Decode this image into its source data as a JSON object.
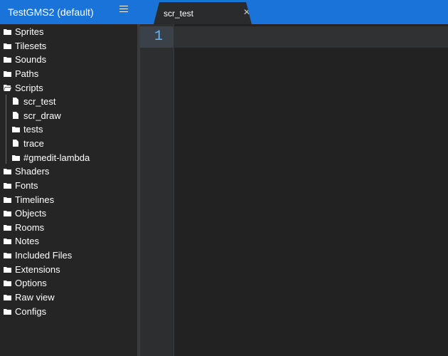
{
  "project": {
    "title": "TestGMS2 (default)"
  },
  "tab": {
    "label": "scr_test",
    "close_glyph": "✕"
  },
  "tree": [
    {
      "label": "Sprites",
      "icon": "folder-icon"
    },
    {
      "label": "Tilesets",
      "icon": "folder-icon"
    },
    {
      "label": "Sounds",
      "icon": "folder-icon"
    },
    {
      "label": "Paths",
      "icon": "folder-icon"
    },
    {
      "label": "Scripts",
      "icon": "folder-open-icon",
      "expanded": true
    },
    {
      "label": "scr_test",
      "icon": "file-icon"
    },
    {
      "label": "scr_draw",
      "icon": "file-icon"
    },
    {
      "label": "tests",
      "icon": "folder-icon"
    },
    {
      "label": "trace",
      "icon": "file-icon"
    },
    {
      "label": "#gmedit-lambda",
      "icon": "folder-icon"
    },
    {
      "label": "Shaders",
      "icon": "folder-icon"
    },
    {
      "label": "Fonts",
      "icon": "folder-icon"
    },
    {
      "label": "Timelines",
      "icon": "folder-icon"
    },
    {
      "label": "Objects",
      "icon": "folder-icon"
    },
    {
      "label": "Rooms",
      "icon": "folder-icon"
    },
    {
      "label": "Notes",
      "icon": "folder-icon"
    },
    {
      "label": "Included Files",
      "icon": "folder-icon"
    },
    {
      "label": "Extensions",
      "icon": "folder-icon"
    },
    {
      "label": "Options",
      "icon": "folder-icon"
    },
    {
      "label": "Raw view",
      "icon": "folder-icon"
    },
    {
      "label": "Configs",
      "icon": "folder-icon"
    }
  ],
  "editor": {
    "line_number": "1"
  },
  "colors": {
    "accent": "#1a73d9",
    "line_number": "#5cb8ff"
  }
}
